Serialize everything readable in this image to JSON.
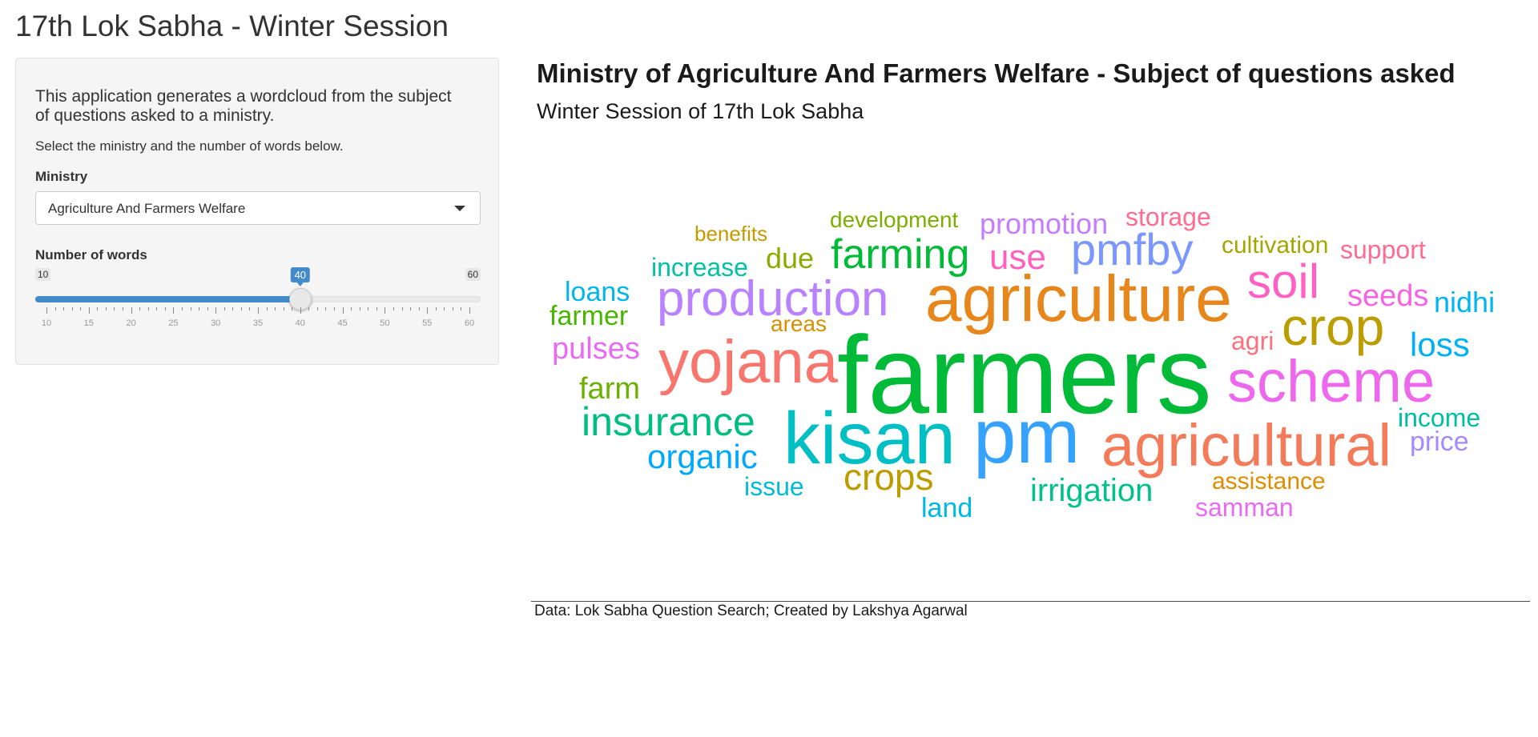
{
  "app": {
    "title": "17th Lok Sabha - Winter Session"
  },
  "sidebar": {
    "description": "This application generates a wordcloud from the subject of questions asked to a ministry.",
    "hint": "Select the ministry and the number of words below.",
    "ministry_label": "Ministry",
    "ministry_value": "Agriculture And Farmers Welfare",
    "words_label": "Number of words",
    "slider": {
      "min": 10,
      "max": 60,
      "value": 40,
      "min_label": "10",
      "max_label": "60",
      "value_label": "40",
      "ticks": [
        "10",
        "15",
        "20",
        "25",
        "30",
        "35",
        "40",
        "45",
        "50",
        "55",
        "60"
      ],
      "accent": "#428bca"
    }
  },
  "plot": {
    "title": "Ministry of Agriculture And Farmers Welfare - Subject of questions asked",
    "subtitle": "Winter Session of 17th Lok Sabha",
    "caption": "Data: Lok Sabha Question Search; Created by Lakshya Agarwal"
  },
  "chart_data": {
    "type": "wordcloud",
    "words": [
      {
        "text": "farmers",
        "color": "#00BA38"
      },
      {
        "text": "pm",
        "color": "#35A2FF"
      },
      {
        "text": "kisan",
        "color": "#00BFC4"
      },
      {
        "text": "agriculture",
        "color": "#E7861B"
      },
      {
        "text": "agricultural",
        "color": "#F37B59"
      },
      {
        "text": "scheme",
        "color": "#ED68ED"
      },
      {
        "text": "yojana",
        "color": "#F8766D"
      },
      {
        "text": "production",
        "color": "#B983FF"
      },
      {
        "text": "crop",
        "color": "#BB9D00"
      },
      {
        "text": "soil",
        "color": "#FF61C3"
      },
      {
        "text": "insurance",
        "color": "#00BF7D"
      },
      {
        "text": "pmfby",
        "color": "#7997FF"
      },
      {
        "text": "farming",
        "color": "#00BA38"
      },
      {
        "text": "crops",
        "color": "#BB9D00"
      },
      {
        "text": "organic",
        "color": "#00A9FF"
      },
      {
        "text": "irrigation",
        "color": "#00C08B"
      },
      {
        "text": "use",
        "color": "#FF62BC"
      },
      {
        "text": "loss",
        "color": "#00B0F6"
      },
      {
        "text": "pulses",
        "color": "#E76BF3"
      },
      {
        "text": "seeds",
        "color": "#F564E3"
      },
      {
        "text": "promotion",
        "color": "#C77CFF"
      },
      {
        "text": "nidhi",
        "color": "#00B4F0"
      },
      {
        "text": "farm",
        "color": "#6BB100"
      },
      {
        "text": "farmer",
        "color": "#49B500"
      },
      {
        "text": "loans",
        "color": "#00B5EE"
      },
      {
        "text": "increase",
        "color": "#00C1A3"
      },
      {
        "text": "due",
        "color": "#8AAB00"
      },
      {
        "text": "storage",
        "color": "#FF6C91"
      },
      {
        "text": "support",
        "color": "#FF6C91"
      },
      {
        "text": "cultivation",
        "color": "#A3A500"
      },
      {
        "text": "development",
        "color": "#7CAE00"
      },
      {
        "text": "income",
        "color": "#00BFA0"
      },
      {
        "text": "price",
        "color": "#A58AFF"
      },
      {
        "text": "agri",
        "color": "#FC717F"
      },
      {
        "text": "areas",
        "color": "#D89000"
      },
      {
        "text": "benefits",
        "color": "#C49A00"
      },
      {
        "text": "issue",
        "color": "#00BCD8"
      },
      {
        "text": "land",
        "color": "#00B8E7"
      },
      {
        "text": "assistance",
        "color": "#DE8C00"
      },
      {
        "text": "samman",
        "color": "#E76BF3"
      }
    ]
  }
}
